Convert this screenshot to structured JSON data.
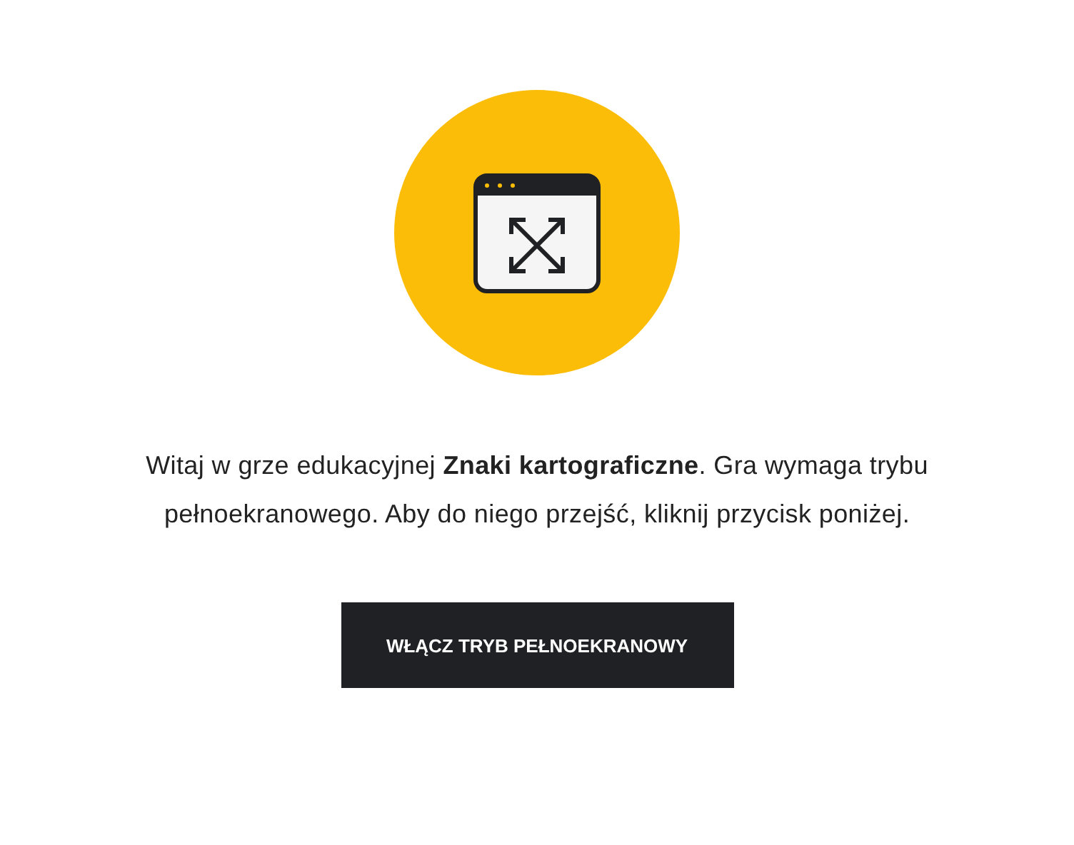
{
  "message": "Witaj w grze edukacyjnej **Znaki kartograficzne**. Gra wymaga trybu pełnoekranowego. Aby do niego przejść, kliknij przycisk poniżej.",
  "button": {
    "label": "WŁĄCZ TRYB PEŁNOEKRANOWY"
  }
}
